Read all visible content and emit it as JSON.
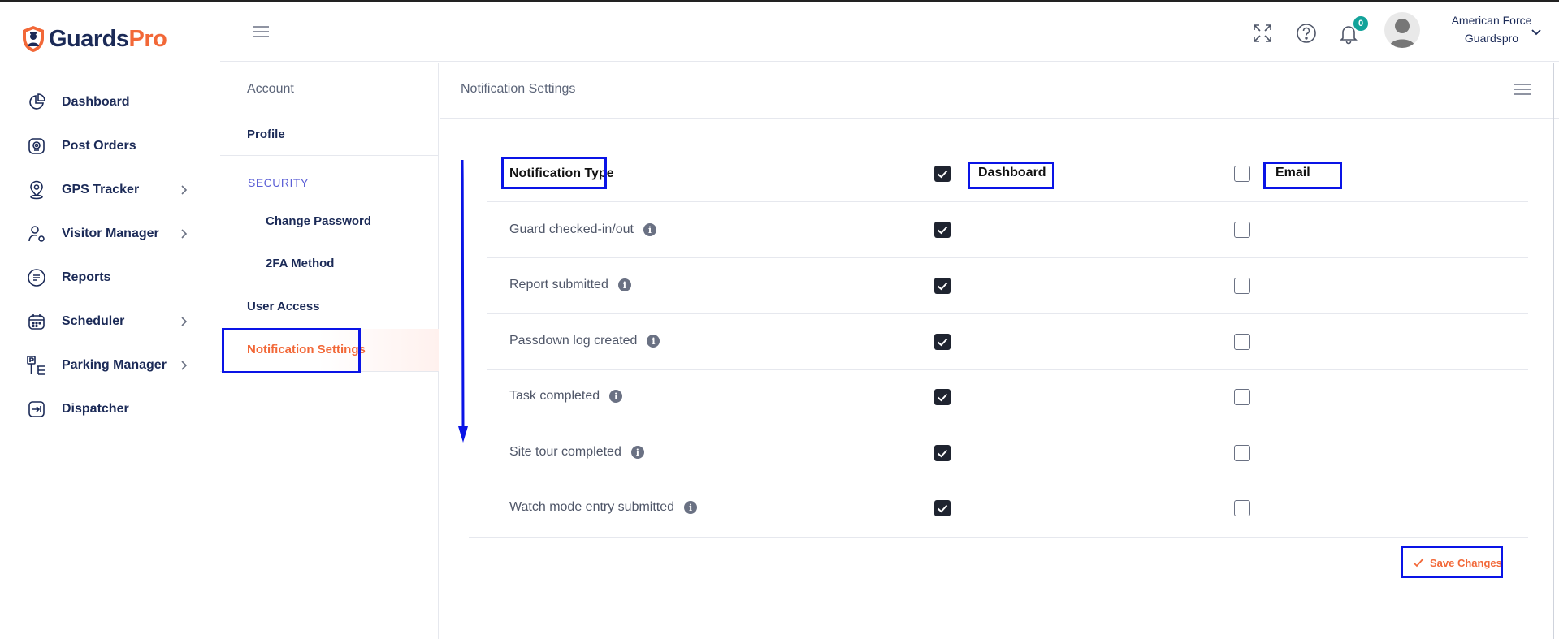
{
  "brand": {
    "name_a": "Guards",
    "name_b": "Pro",
    "primary": "#1b2a57",
    "accent": "#f26838"
  },
  "sidebar": {
    "items": [
      {
        "label": "Dashboard",
        "icon": "pie-chart-icon",
        "has_children": false
      },
      {
        "label": "Post Orders",
        "icon": "badge-icon",
        "has_children": false
      },
      {
        "label": "GPS Tracker",
        "icon": "location-pin-icon",
        "has_children": true
      },
      {
        "label": "Visitor Manager",
        "icon": "user-gear-icon",
        "has_children": true
      },
      {
        "label": "Reports",
        "icon": "document-icon",
        "has_children": false
      },
      {
        "label": "Scheduler",
        "icon": "calendar-icon",
        "has_children": true
      },
      {
        "label": "Parking Manager",
        "icon": "parking-icon",
        "has_children": true
      },
      {
        "label": "Dispatcher",
        "icon": "dispatch-icon",
        "has_children": false
      }
    ]
  },
  "header": {
    "notifications_count": "0",
    "user": {
      "name": "American Force",
      "org": "Guardspro"
    }
  },
  "settings_menu": {
    "account": "Account",
    "profile": "Profile",
    "security": "SECURITY",
    "change_password": "Change Password",
    "two_fa": "2FA Method",
    "user_access": "User Access",
    "notification_settings": "Notification Settings"
  },
  "main": {
    "title": "Notification Settings",
    "columns": {
      "type": "Notification Type",
      "dashboard": "Dashboard",
      "email": "Email"
    },
    "header_checks": {
      "dashboard": true,
      "email": false
    },
    "rows": [
      {
        "label": "Guard checked-in/out",
        "dashboard": true,
        "email": false
      },
      {
        "label": "Report submitted",
        "dashboard": true,
        "email": false
      },
      {
        "label": "Passdown log created",
        "dashboard": true,
        "email": false
      },
      {
        "label": "Task completed",
        "dashboard": true,
        "email": false
      },
      {
        "label": "Site tour completed",
        "dashboard": true,
        "email": false
      },
      {
        "label": "Watch mode entry submitted",
        "dashboard": true,
        "email": false
      }
    ],
    "save_label": "Save Changes"
  },
  "colors": {
    "highlight_box": "#0a14e6",
    "badge": "#13a39a",
    "security_label": "#5b5fd6"
  }
}
